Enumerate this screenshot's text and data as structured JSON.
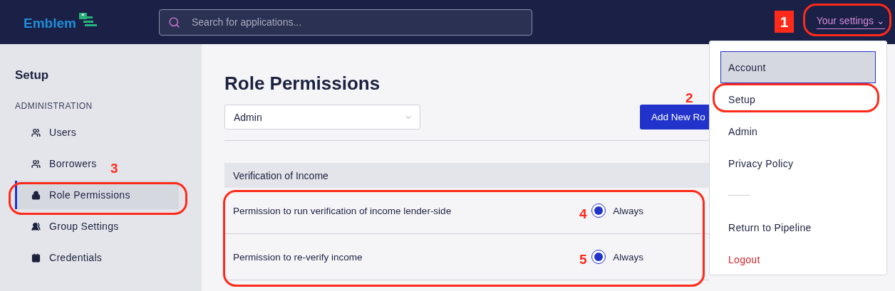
{
  "header": {
    "logo": "Emblem",
    "search": {
      "placeholder": "Search for applications..."
    },
    "settings_link": "Your settings ⌄"
  },
  "sidebar": {
    "title": "Setup",
    "section": "ADMINISTRATION",
    "items": [
      {
        "label": "Users",
        "selected": false
      },
      {
        "label": "Borrowers",
        "selected": false
      },
      {
        "label": "Role Permissions",
        "selected": true
      },
      {
        "label": "Group Settings",
        "selected": false
      },
      {
        "label": "Credentials",
        "selected": false
      }
    ]
  },
  "main": {
    "title": "Role Permissions",
    "role_select": "Admin",
    "add_button": "Add New Ro",
    "section": "Verification of Income",
    "permissions": [
      {
        "label": "Permission to run verification of income lender-side",
        "option": "Always",
        "selected": true
      },
      {
        "label": "Permission to re-verify income",
        "option": "Always",
        "selected": true
      }
    ]
  },
  "menu": {
    "items": [
      {
        "label": "Account",
        "kind": "item",
        "selected": true
      },
      {
        "label": "Setup",
        "kind": "item",
        "selected": false
      },
      {
        "label": "Admin",
        "kind": "item",
        "selected": false
      },
      {
        "label": "Privacy Policy",
        "kind": "item",
        "selected": false
      },
      {
        "kind": "divider"
      },
      {
        "label": "Return to Pipeline",
        "kind": "item",
        "selected": false
      },
      {
        "label": "Logout",
        "kind": "danger",
        "selected": false
      }
    ]
  },
  "annotations": [
    {
      "number": "1",
      "kind": "badge"
    },
    {
      "number": "2",
      "kind": "plain"
    },
    {
      "number": "3",
      "kind": "plain"
    },
    {
      "number": "4",
      "kind": "plain"
    },
    {
      "number": "5",
      "kind": "plain"
    }
  ]
}
